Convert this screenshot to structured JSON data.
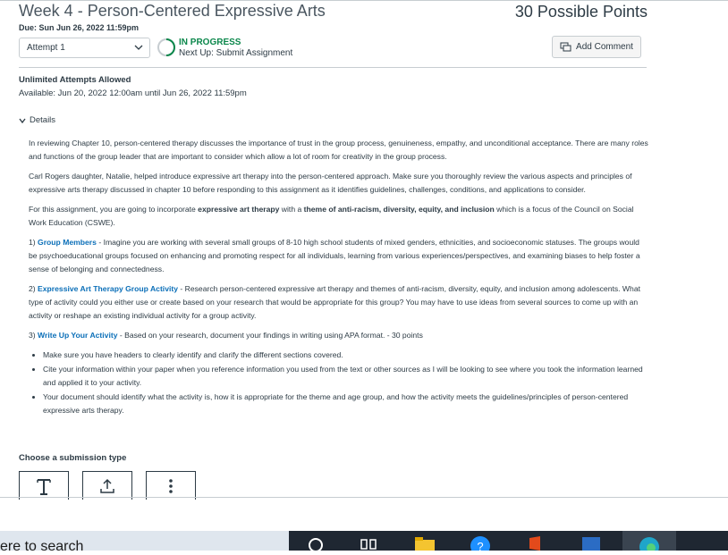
{
  "assignment": {
    "title": "Week 4 - Person-Centered Expressive Arts",
    "due": "Due: Sun Jun 26, 2022 11:59pm",
    "points": "30 Possible Points",
    "attempt_label": "Attempt 1",
    "status": "IN PROGRESS",
    "next_up": "Next Up: Submit Assignment",
    "add_comment": "Add Comment",
    "unlimited": "Unlimited Attempts Allowed",
    "available": "Available: Jun 20, 2022 12:00am until Jun 26, 2022 11:59pm",
    "details_label": "Details"
  },
  "details": {
    "p1": "In reviewing Chapter 10, person-centered therapy discusses the importance of trust in the group process, genuineness, empathy, and unconditional acceptance. There are many roles and functions of the group leader that are important to consider which allow a lot of room for creativity in the group process.",
    "p2": "Carl Rogers daughter, Natalie, helped introduce expressive art therapy into the person-centered approach. Make sure you thoroughly review the various aspects and principles of expressive arts therapy discussed in chapter 10 before responding to this assignment as it identifies guidelines, challenges, conditions, and applications to consider.",
    "p3_a": "For this assignment, you are going to incorporate ",
    "p3_b": "expressive art therapy",
    "p3_c": " with a ",
    "p3_d": "theme of anti-racism, diversity, equity, and inclusion",
    "p3_e": " which is a focus of the Council on Social Work Education (CSWE).",
    "s1_num": "1) ",
    "s1_link": "Group Members",
    "s1_text": " - Imagine you are working with several small groups of 8-10 high school students of mixed genders, ethnicities, and socioeconomic statuses. The groups would be psychoeducational groups focused on enhancing and promoting respect for all individuals, learning from various experiences/perspectives, and examining biases to help foster a sense of belonging and connectedness.",
    "s2_num": "2) ",
    "s2_link": "Expressive Art Therapy Group Activity",
    "s2_text": " - Research person-centered expressive art therapy and themes of anti-racism, diversity, equity, and inclusion among adolescents. What type of activity could you either use or create based on your research that would be appropriate for this group? You may have to use ideas from several sources to come up with an activity or reshape an existing individual activity for a group activity.",
    "s3_num": "3) ",
    "s3_link": "Write Up Your Activity",
    "s3_text": " - Based on your research, document your findings in writing using APA format. - 30 points",
    "bullets": [
      "Make sure you have headers to clearly identify and clarify the different sections covered.",
      "Cite your information within your paper when you reference information you used from the text or other sources as I will be looking to see where you took the information learned and applied it to your activity.",
      "Your document should identify what the activity is, how it is appropriate for the theme and age group, and how the activity meets the guidelines/principles of person-centered expressive arts therapy."
    ]
  },
  "submission": {
    "choose_label": "Choose a submission type",
    "types": [
      "text-entry-icon",
      "upload-icon",
      "more-options-icon"
    ]
  },
  "taskbar": {
    "search_text": "ere to search"
  },
  "colors": {
    "link": "#0b6fb8",
    "status_green": "#0b874b",
    "text": "#2d3b45"
  }
}
